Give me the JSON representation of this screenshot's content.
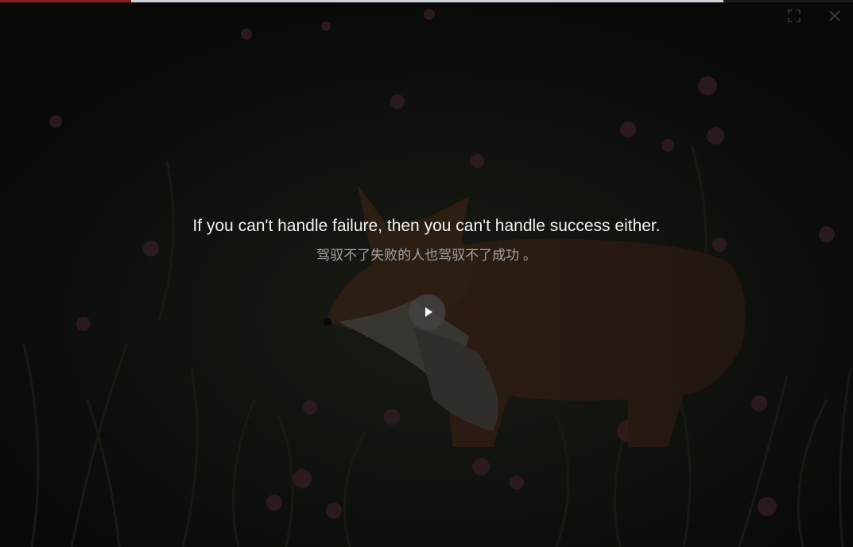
{
  "quote": {
    "english": "If you can't handle failure, then you can't handle success either.",
    "chinese": "驾驭不了失败的人也驾驭不了成功 。"
  },
  "controls": {
    "fullscreen_icon": "fullscreen-icon",
    "close_icon": "close-icon",
    "play_icon": "play-icon"
  },
  "colors": {
    "quote_text": "#f2f2f2",
    "translation_text": "#a3a3a3",
    "background": "#111510"
  }
}
